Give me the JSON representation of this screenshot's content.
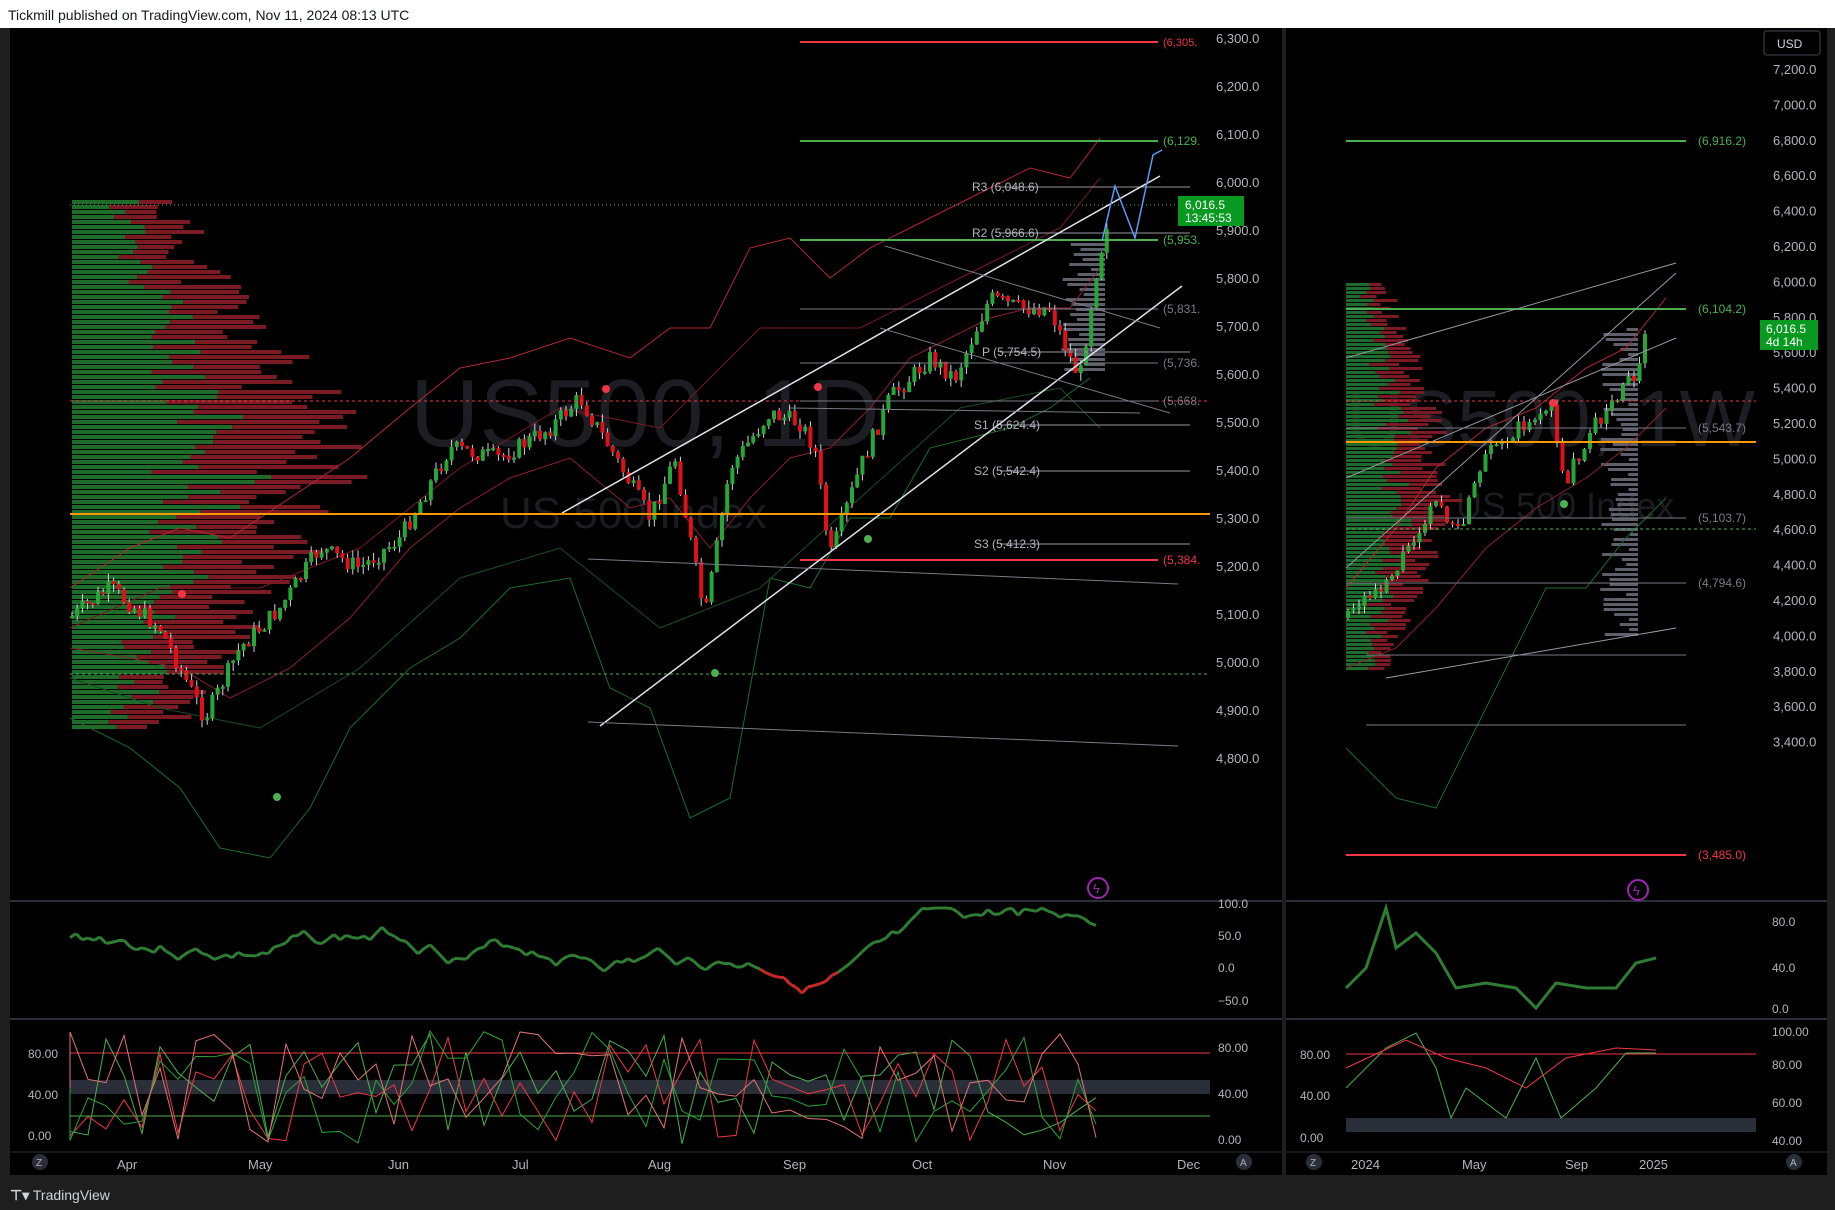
{
  "header": {
    "publisher": "Tickmill published on TradingView.com, Nov 11, 2024 08:13 UTC"
  },
  "footer": {
    "brand": "TradingView"
  },
  "left_chart": {
    "watermark_symbol": "US500, 1D",
    "watermark_name": "US 500 Index",
    "price_axis": [
      "6,300.0",
      "6,200.0",
      "6,100.0",
      "6,000.0",
      "5,900.0",
      "5,800.0",
      "5,700.0",
      "5,600.0",
      "5,500.0",
      "5,400.0",
      "5,300.0",
      "5,200.0",
      "5,100.0",
      "5,000.0",
      "4,900.0",
      "4,800.0"
    ],
    "time_axis": [
      "Apr",
      "May",
      "Jun",
      "Jul",
      "Aug",
      "Sep",
      "Oct",
      "Nov",
      "Dec"
    ],
    "last_price": "6,016.5",
    "countdown": "13:45:53",
    "levels": [
      {
        "label": "(6,305.",
        "color": "#f23645"
      },
      {
        "label": "(6,129.",
        "color": "#4caf50"
      },
      {
        "label": "(5,953.",
        "color": "#4caf50"
      },
      {
        "label": "(5,831.",
        "color": "#787b86"
      },
      {
        "label": "(5,736.",
        "color": "#787b86"
      },
      {
        "label": "(5,668.",
        "color": "#787b86"
      },
      {
        "label": "(5,384.",
        "color": "#f23645"
      }
    ],
    "pivots": [
      "R3 (6,048.6)",
      "R2 (5,966.6)",
      "P (5,754.5)",
      "S1 (5,624.4)",
      "S2 (5,542.4)",
      "S3 (5,412.3)"
    ],
    "osc1_axis": [
      "100.0",
      "50.0",
      "0.0",
      "−50.0"
    ],
    "osc2_axis_left": [
      "80.00",
      "40.00",
      "0.00"
    ],
    "osc2_axis_right": [
      "80.00",
      "40.00",
      "0.00"
    ]
  },
  "right_chart": {
    "currency": "USD",
    "watermark_symbol": "US500, 1W",
    "watermark_name": "US 500 Index",
    "price_axis": [
      "7,200.0",
      "7,000.0",
      "6,800.0",
      "6,600.0",
      "6,400.0",
      "6,200.0",
      "6,000.0",
      "5,800.0",
      "5,600.0",
      "5,400.0",
      "5,200.0",
      "5,000.0",
      "4,800.0",
      "4,600.0",
      "4,400.0",
      "4,200.0",
      "4,000.0",
      "3,800.0",
      "3,600.0",
      "3,400.0"
    ],
    "time_axis": [
      "2024",
      "May",
      "Sep",
      "2025"
    ],
    "last_price": "6,016.5",
    "countdown": "4d 14h",
    "levels": [
      {
        "label": "(6,916.2)",
        "color": "#4caf50"
      },
      {
        "label": "(6,104.2)",
        "color": "#4caf50"
      },
      {
        "label": "(5,543.7)",
        "color": "#787b86"
      },
      {
        "label": "(5,103.7)",
        "color": "#787b86"
      },
      {
        "label": "(4,794.6)",
        "color": "#787b86"
      },
      {
        "label": "(3,485.0)",
        "color": "#f23645"
      }
    ],
    "osc1_axis": [
      "80.0",
      "40.0",
      "0.0"
    ],
    "osc2_axis_left": [
      "80.00",
      "40.00",
      "0.00"
    ],
    "osc2_axis_right": [
      "100.00",
      "80.00",
      "60.00",
      "40.00"
    ]
  },
  "colors": {
    "up": "#089981",
    "bull": "#26a637",
    "bear": "#e0101a",
    "bg": "#000000"
  }
}
